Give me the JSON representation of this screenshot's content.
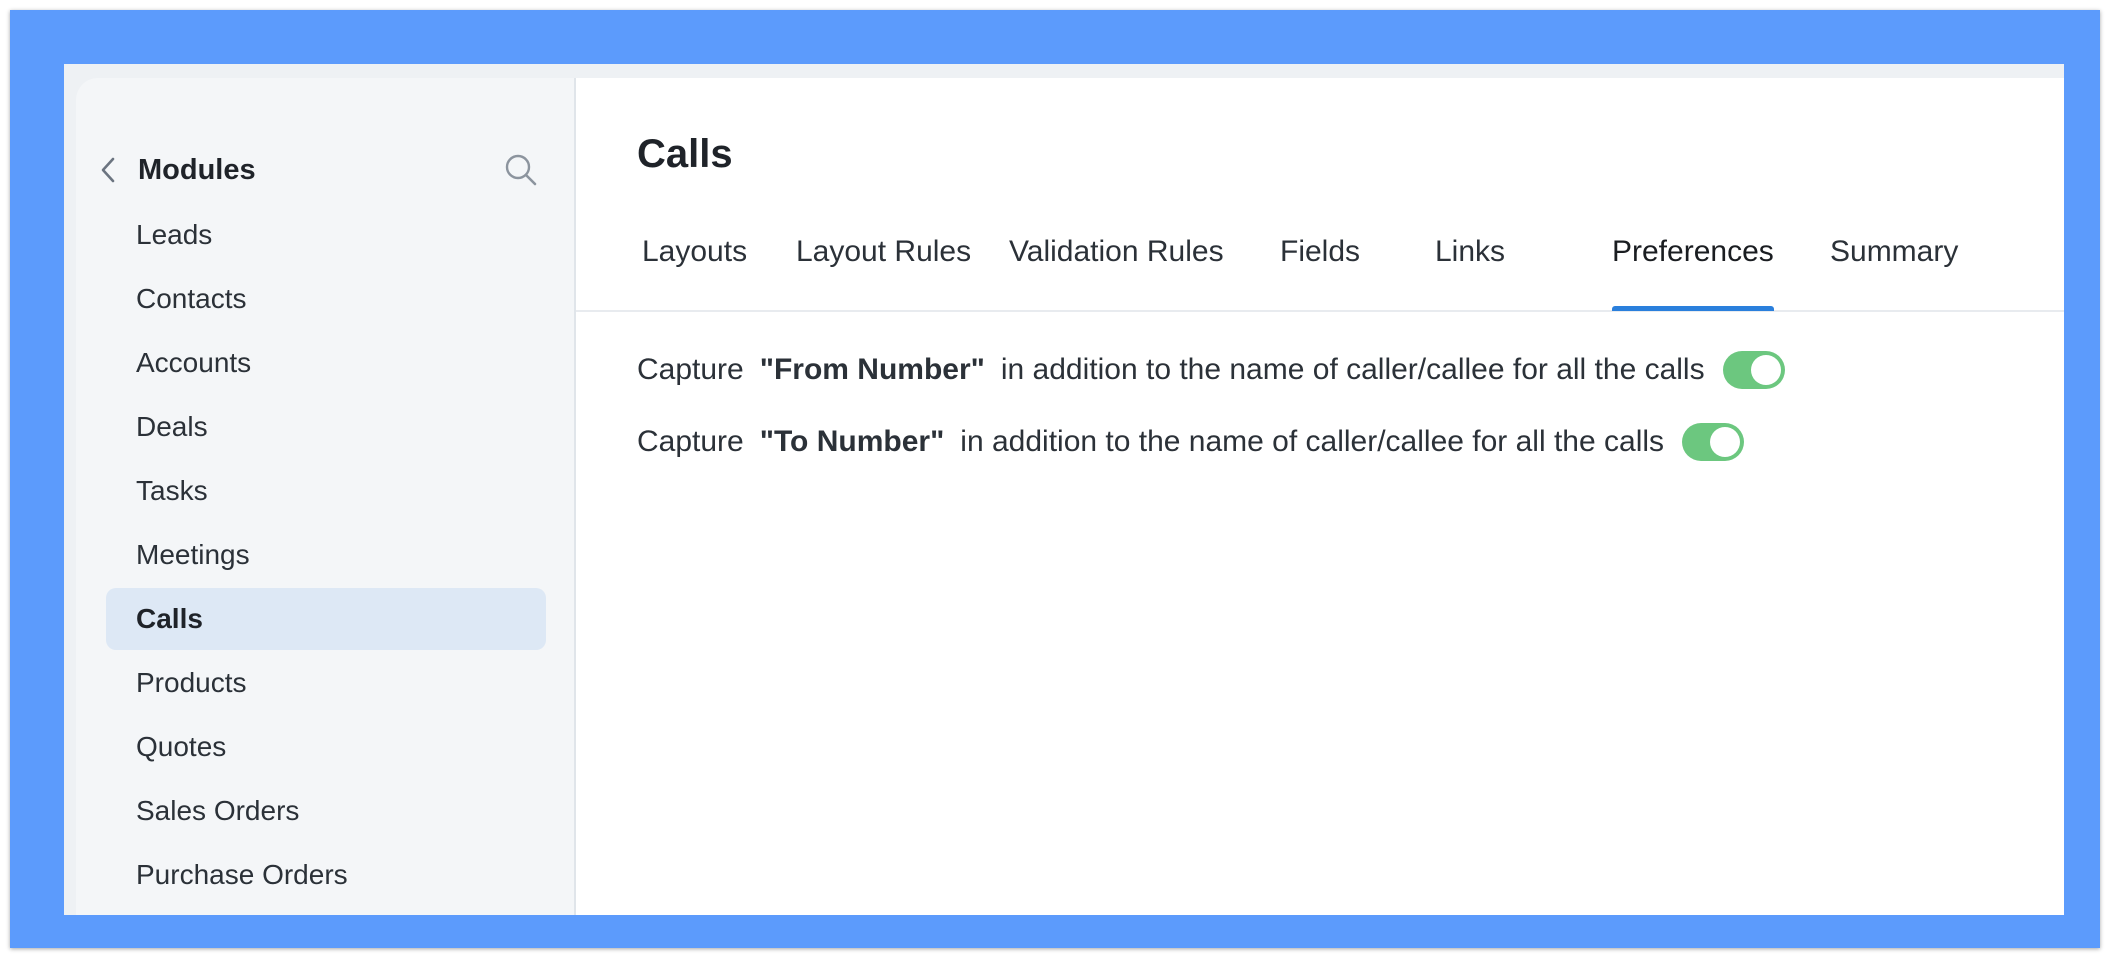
{
  "sidebar": {
    "title": "Modules",
    "items": [
      {
        "label": "Leads"
      },
      {
        "label": "Contacts"
      },
      {
        "label": "Accounts"
      },
      {
        "label": "Deals"
      },
      {
        "label": "Tasks"
      },
      {
        "label": "Meetings"
      },
      {
        "label": "Calls",
        "active": true
      },
      {
        "label": "Products"
      },
      {
        "label": "Quotes"
      },
      {
        "label": "Sales Orders"
      },
      {
        "label": "Purchase Orders"
      }
    ]
  },
  "main": {
    "title": "Calls",
    "tabs": [
      {
        "label": "Layouts"
      },
      {
        "label": "Layout Rules"
      },
      {
        "label": "Validation Rules"
      },
      {
        "label": "Fields"
      },
      {
        "label": "Links"
      },
      {
        "label": "Preferences",
        "active": true
      },
      {
        "label": "Summary"
      }
    ],
    "preferences": [
      {
        "prefix": "Capture",
        "field": "\"From Number\"",
        "suffix": "in addition to the name of caller/callee for all the calls",
        "enabled": true
      },
      {
        "prefix": "Capture",
        "field": "\"To Number\"",
        "suffix": "in addition to the name of caller/callee for all the calls",
        "enabled": true
      }
    ]
  },
  "colors": {
    "frame": "#5c9bfc",
    "active_tab_underline": "#2a7fdc",
    "active_module_bg": "#dde8f5",
    "toggle_on": "#6cc77f"
  },
  "icons": {
    "back": "chevron-left-icon",
    "search": "search-icon"
  }
}
